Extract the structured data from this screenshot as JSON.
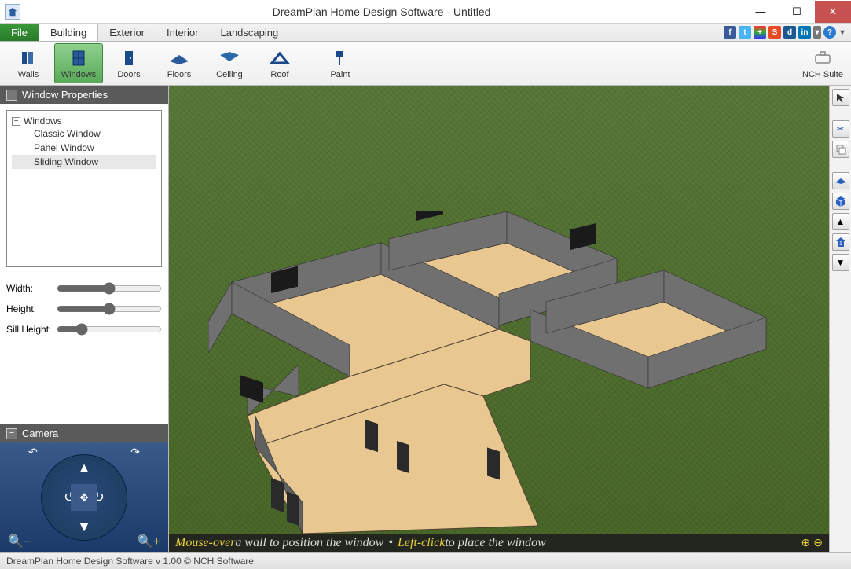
{
  "window": {
    "title": "DreamPlan Home Design Software - Untitled"
  },
  "menu": {
    "file": "File",
    "items": [
      "Building",
      "Exterior",
      "Interior",
      "Landscaping"
    ],
    "active": "Building"
  },
  "social_icons": [
    "facebook",
    "twitter",
    "google-plus",
    "stumbleupon",
    "digg",
    "linkedin",
    "dropdown",
    "help"
  ],
  "toolbar": {
    "items": [
      {
        "label": "Walls",
        "icon": "walls"
      },
      {
        "label": "Windows",
        "icon": "windows",
        "active": true
      },
      {
        "label": "Doors",
        "icon": "doors"
      },
      {
        "label": "Floors",
        "icon": "floors"
      },
      {
        "label": "Ceiling",
        "icon": "ceiling"
      },
      {
        "label": "Roof",
        "icon": "roof"
      },
      {
        "label": "Paint",
        "icon": "paint"
      }
    ],
    "suite": "NCH Suite"
  },
  "properties": {
    "title": "Window Properties",
    "tree_root": "Windows",
    "tree_items": [
      "Classic Window",
      "Panel Window",
      "Sliding Window"
    ],
    "selected": "Sliding Window",
    "sliders": [
      {
        "label": "Width:"
      },
      {
        "label": "Height:"
      },
      {
        "label": "Sill Height:"
      }
    ]
  },
  "camera": {
    "title": "Camera"
  },
  "hint": {
    "kw1": "Mouse-over",
    "t1": " a wall to position the window ",
    "dot": "•",
    "kw2": " Left-click",
    "t2": " to place the window"
  },
  "right_tools": [
    "cursor",
    "cut",
    "copy",
    "sep",
    "floor-level",
    "cube-3d",
    "up",
    "floor-1",
    "down"
  ],
  "status": "DreamPlan Home Design Software v 1.00 © NCH Software"
}
